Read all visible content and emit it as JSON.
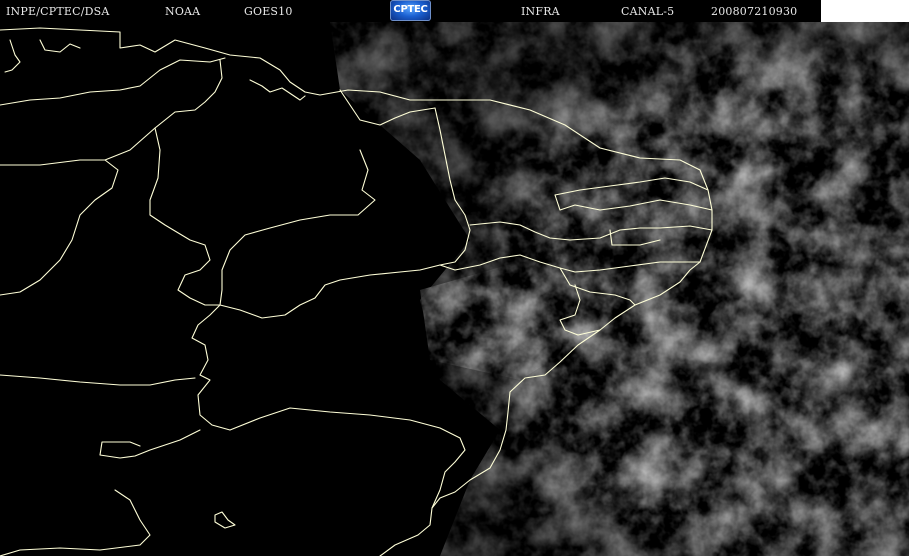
{
  "header": {
    "source_label": "INPE/CPTEC/DSA",
    "agency_label": "NOAA",
    "satellite_label": "GOES10",
    "logo_text": "CPTEC",
    "band_label": "INFRA",
    "channel_label": "CANAL-5",
    "timestamp": "200807210930"
  },
  "imagery": {
    "type": "infrared satellite image",
    "region": "Northeast Brazil and adjacent Atlantic",
    "colors": {
      "background": "#000000",
      "cloud": "#9a9a9a",
      "outline": "#ffffd8"
    }
  }
}
